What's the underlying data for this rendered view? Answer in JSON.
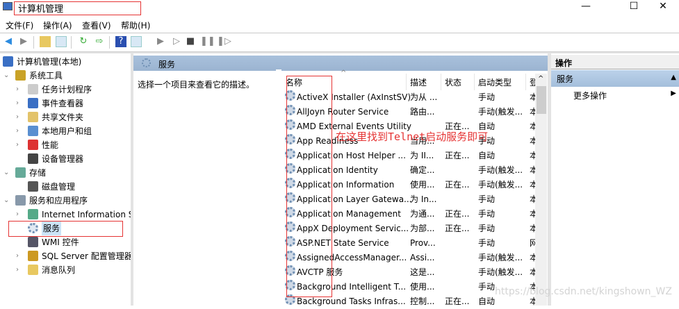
{
  "window": {
    "title": "计算机管理",
    "minimize": "—",
    "maximize": "☐",
    "close": "✕"
  },
  "menu": [
    "文件(F)",
    "操作(A)",
    "查看(V)",
    "帮助(H)"
  ],
  "tree": [
    {
      "label": "计算机管理(本地)",
      "level": 0,
      "chev": ""
    },
    {
      "label": "系统工具",
      "level": 1,
      "chev": "⌄"
    },
    {
      "label": "任务计划程序",
      "level": 2,
      "chev": "›"
    },
    {
      "label": "事件查看器",
      "level": 2,
      "chev": "›"
    },
    {
      "label": "共享文件夹",
      "level": 2,
      "chev": "›"
    },
    {
      "label": "本地用户和组",
      "level": 2,
      "chev": "›"
    },
    {
      "label": "性能",
      "level": 2,
      "chev": "›"
    },
    {
      "label": "设备管理器",
      "level": 2,
      "chev": ""
    },
    {
      "label": "存储",
      "level": 1,
      "chev": "⌄"
    },
    {
      "label": "磁盘管理",
      "level": 2,
      "chev": ""
    },
    {
      "label": "服务和应用程序",
      "level": 1,
      "chev": "⌄"
    },
    {
      "label": "Internet Information Services",
      "level": 2,
      "chev": "›"
    },
    {
      "label": "服务",
      "level": 2,
      "chev": "",
      "selected": true
    },
    {
      "label": "WMI 控件",
      "level": 2,
      "chev": ""
    },
    {
      "label": "SQL Server 配置管理器",
      "level": 2,
      "chev": "›"
    },
    {
      "label": "消息队列",
      "level": 2,
      "chev": "›"
    }
  ],
  "center": {
    "header": "服务",
    "description": "选择一个项目来查看它的描述。",
    "columns": [
      "名称",
      "描述",
      "状态",
      "启动类型",
      "登"
    ],
    "rows": [
      [
        "ActiveX Installer (AxInstSV)",
        "为从 ...",
        "",
        "手动",
        "本"
      ],
      [
        "AllJoyn Router Service",
        "路由...",
        "",
        "手动(触发...",
        "本"
      ],
      [
        "AMD External Events Utility",
        "",
        "正在...",
        "自动",
        "本"
      ],
      [
        "App Readiness",
        "当用...",
        "",
        "手动",
        "本"
      ],
      [
        "Application Host Helper ...",
        "为 II...",
        "正在...",
        "自动",
        "本"
      ],
      [
        "Application Identity",
        "确定...",
        "",
        "手动(触发...",
        "本"
      ],
      [
        "Application Information",
        "使用...",
        "正在...",
        "手动(触发...",
        "本"
      ],
      [
        "Application Layer Gatewa...",
        "为 In...",
        "",
        "手动",
        "本"
      ],
      [
        "Application Management",
        "为通...",
        "正在...",
        "手动",
        "本"
      ],
      [
        "AppX Deployment Servic...",
        "为部...",
        "正在...",
        "手动",
        "本"
      ],
      [
        "ASP.NET State Service",
        "Prov...",
        "",
        "手动",
        "网"
      ],
      [
        "AssignedAccessManager...",
        "Assi...",
        "",
        "手动(触发...",
        "本"
      ],
      [
        "AVCTP 服务",
        "这是...",
        "",
        "手动(触发...",
        "本"
      ],
      [
        "Background Intelligent T...",
        "使用...",
        "",
        "手动",
        "本"
      ],
      [
        "Background Tasks Infras...",
        "控制...",
        "正在...",
        "自动",
        "本"
      ]
    ]
  },
  "actions": {
    "title": "操作",
    "section": "服务",
    "more": "更多操作"
  },
  "annotation": "在这里找到Telnet启动服务即可",
  "watermark": "https://blog.csdn.net/kingshown_WZ"
}
